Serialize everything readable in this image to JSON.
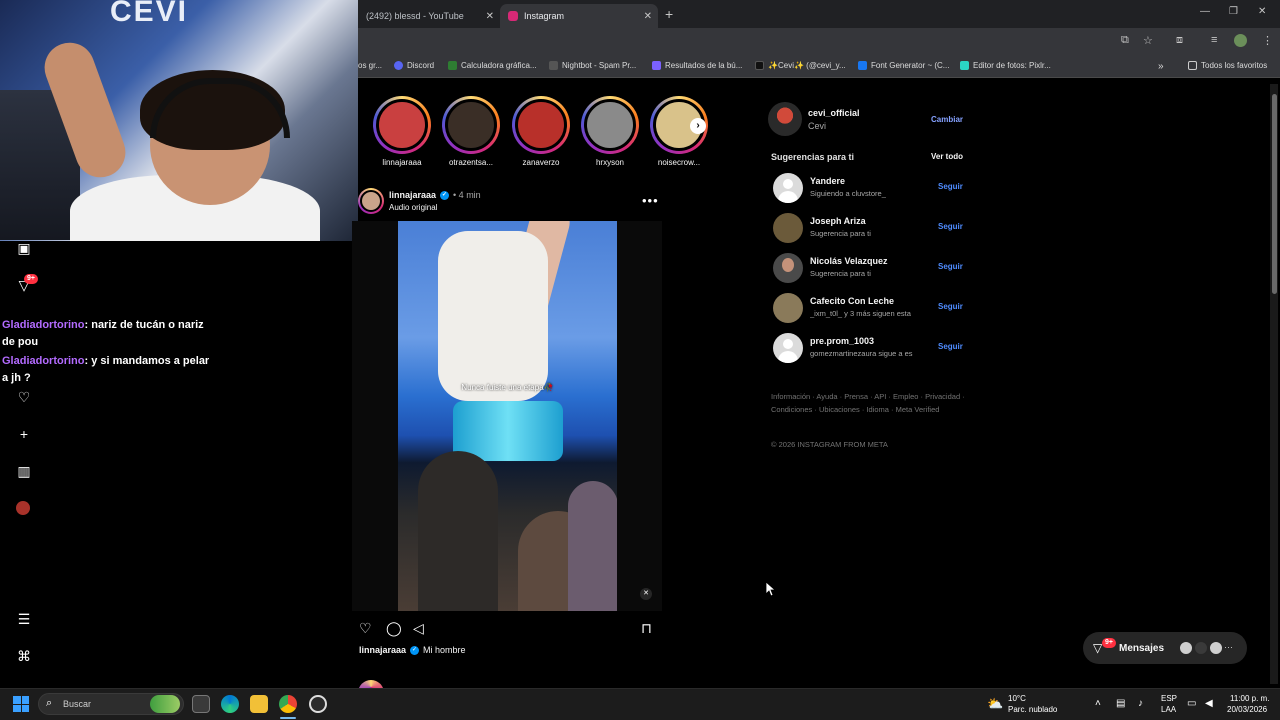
{
  "browser": {
    "tabs": [
      {
        "label": "(2492) blessd - YouTube",
        "color": "#ff0000",
        "active": false
      },
      {
        "label": "Instagram",
        "color": "#d62976",
        "active": true
      }
    ],
    "bookmarks": [
      {
        "label": "os gr...",
        "color": "#4285f4"
      },
      {
        "label": "Discord",
        "color": "#5865f2"
      },
      {
        "label": "Calculadora gráfica...",
        "color": "#2e7d32"
      },
      {
        "label": "Nightbot - Spam Pr...",
        "color": "#555555"
      },
      {
        "label": "Resultados de la bú...",
        "color": "#7b61ff"
      },
      {
        "label": "✨Cevi✨ (@cevi_y...",
        "color": "#000000"
      },
      {
        "label": "Font Generator ~ (C...",
        "color": "#1877f2"
      },
      {
        "label": "Editor de fotos: Pixlr...",
        "color": "#2bd4c4"
      }
    ],
    "bookmarks_folder": "Todos los favoritos"
  },
  "webcam": {
    "logo_text": "CEVI"
  },
  "chat": [
    {
      "user": "Gladiadortorino",
      "message": ": nariz de tucán o nariz de pou"
    },
    {
      "user": "Gladiadortorino",
      "message": ": y si mandamos a pelar a jh ?"
    }
  ],
  "nav": {
    "notification_badge": "9+"
  },
  "stories": [
    {
      "name": "linnajaraaa",
      "color": "#c94040"
    },
    {
      "name": "otrazentsa...",
      "color": "#3a2e26"
    },
    {
      "name": "zanaverzo",
      "color": "#b8302a"
    },
    {
      "name": "hrxyson",
      "color": "#8a8a8a"
    },
    {
      "name": "noisecrow...",
      "color": "#d9c28a"
    }
  ],
  "post": {
    "username": "linnajaraaa",
    "time": "• 4 min",
    "audio": "Audio original",
    "video_caption": "Nunca fuiste una etapa🥀",
    "caption_user": "linnajaraaa",
    "caption_text": "Mi hombre"
  },
  "sidebar": {
    "me_username": "cevi_official",
    "me_name": "Cevi",
    "switch_label": "Cambiar",
    "suggestions_title": "Sugerencias para ti",
    "see_all": "Ver todo",
    "follow_label": "Seguir",
    "suggestions": [
      {
        "name": "Yandere",
        "sub": "Siguiendo a cluvstore_"
      },
      {
        "name": "Joseph Ariza",
        "sub": "Sugerencia para ti"
      },
      {
        "name": "Nicolás Velazquez",
        "sub": "Sugerencia para ti"
      },
      {
        "name": "Cafecito Con Leche",
        "sub": "_ixm_t0l_ y 3 más siguen esta"
      },
      {
        "name": "pre.prom_1003",
        "sub": "gomezmartinezaura sigue a es"
      }
    ],
    "footer_links": "Información · Ayuda · Prensa · API · Empleo · Privacidad · Condiciones · Ubicaciones · Idioma · Meta Verified",
    "copyright": "© 2026 INSTAGRAM FROM META"
  },
  "messages": {
    "label": "Mensajes",
    "badge": "9+"
  },
  "taskbar": {
    "search_placeholder": "Buscar",
    "weather_temp": "10°C",
    "weather_desc": "Parc. nublado",
    "lang1": "ESP",
    "lang2": "LAA",
    "time": "11:00 p. m.",
    "date": "20/03/2026"
  }
}
